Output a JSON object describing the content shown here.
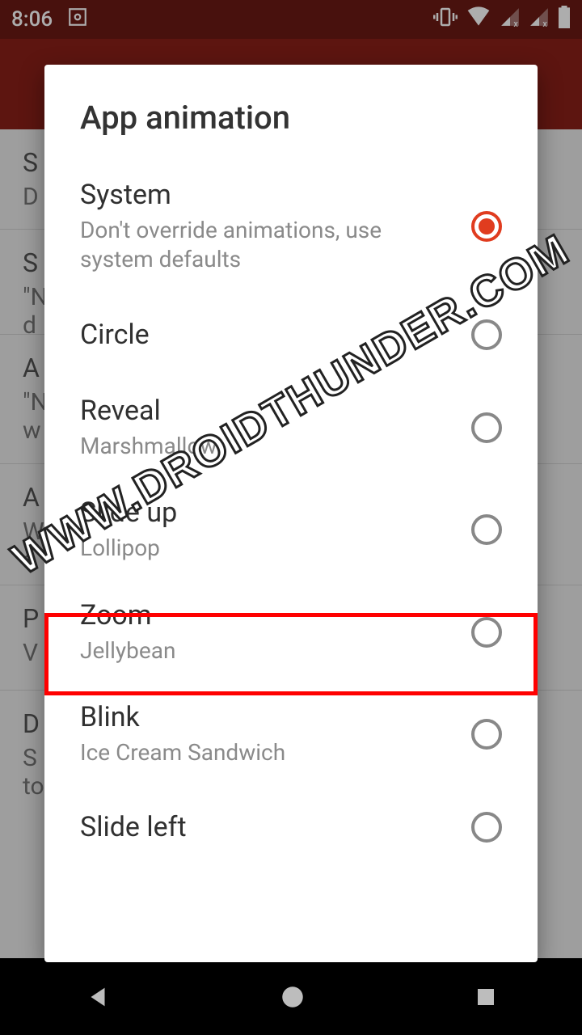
{
  "statusbar": {
    "time": "8:06"
  },
  "dialog": {
    "title": "App animation",
    "options": [
      {
        "label": "System",
        "sub": "Don't override animations, use system defaults",
        "selected": true
      },
      {
        "label": "Circle",
        "sub": ""
      },
      {
        "label": "Reveal",
        "sub": "Marshmallow"
      },
      {
        "label": "Slide up",
        "sub": "Lollipop"
      },
      {
        "label": "Zoom",
        "sub": "Jellybean",
        "highlighted": true
      },
      {
        "label": "Blink",
        "sub": "Ice Cream Sandwich"
      },
      {
        "label": "Slide left",
        "sub": ""
      }
    ]
  },
  "watermark": "WWW.DROIDTHUNDER.COM",
  "bg_items": [
    {
      "t": "S",
      "s": "D"
    },
    {
      "t": "S",
      "s": "\"N\nd"
    },
    {
      "t": "A",
      "s": "\"N\nw"
    },
    {
      "t": "A",
      "s": "W\ns"
    },
    {
      "t": "P",
      "s": "V"
    },
    {
      "t": "D",
      "s": "S\nto"
    }
  ]
}
